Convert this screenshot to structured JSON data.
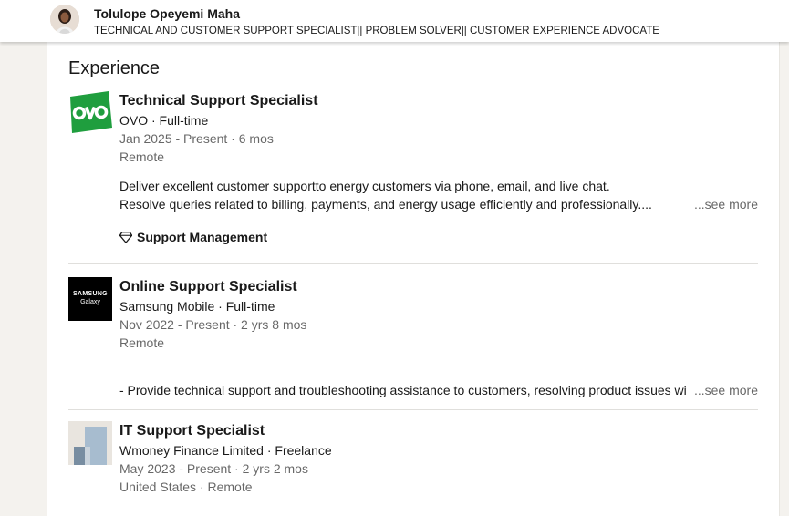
{
  "profile": {
    "name": "Tolulope Opeyemi Maha",
    "headline": "TECHNICAL AND CUSTOMER SUPPORT SPECIALIST|| PROBLEM SOLVER|| CUSTOMER EXPERIENCE ADVOCATE"
  },
  "section": {
    "title": "Experience"
  },
  "experiences": [
    {
      "role": "Technical Support Specialist",
      "company": "OVO · Full-time",
      "dates": "Jan 2025 - Present · 6 mos",
      "location": "Remote",
      "logo_text": "ovo",
      "desc_lines": [
        "Deliver excellent customer supportto energy customers via phone, email, and live chat.",
        "Resolve queries related to billing, payments, and energy usage efficiently and professionally...."
      ],
      "see_more": "...see more",
      "skill": "Support Management"
    },
    {
      "role": "Online Support Specialist",
      "company": "Samsung Mobile · Full-time",
      "dates": "Nov 2022 - Present · 2 yrs 8 mos",
      "location": "Remote",
      "logo_text_1": "SAMSUNG",
      "logo_text_2": "Galaxy",
      "desc_lines": [
        "- Provide technical support and troubleshooting assistance to customers, resolving product issues wit"
      ],
      "see_more": "...see more"
    },
    {
      "role": "IT Support Specialist",
      "company": "Wmoney Finance Limited · Freelance",
      "dates": "May 2023 - Present · 2 yrs 2 mos",
      "location": "United States · Remote"
    }
  ],
  "colors": {
    "ovo_green": "#1f9e3e",
    "page_bg": "#f4f2ee"
  }
}
